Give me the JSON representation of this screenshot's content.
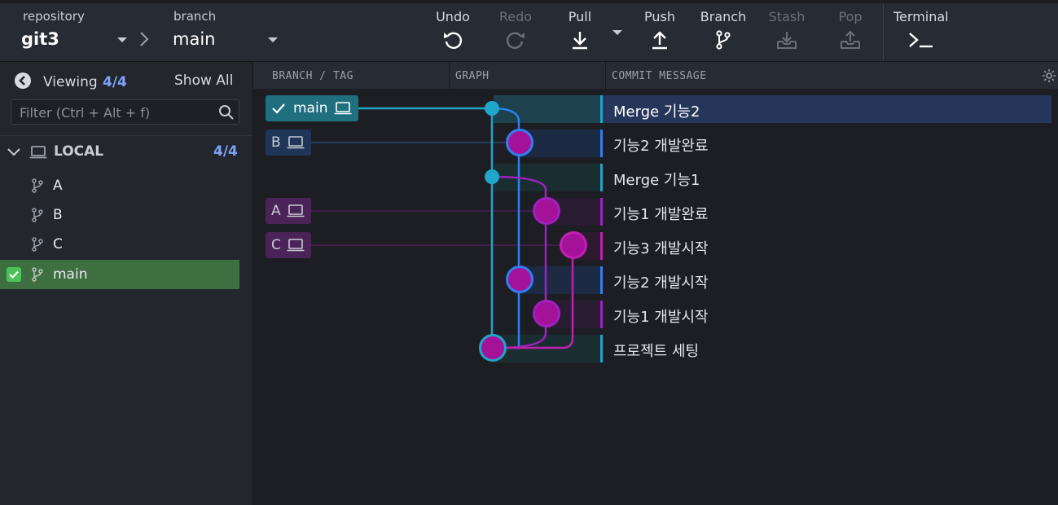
{
  "toolbar": {
    "repo_label": "repository",
    "repo_value": "git3",
    "branch_label": "branch",
    "branch_value": "main",
    "undo": "Undo",
    "redo": "Redo",
    "pull": "Pull",
    "push": "Push",
    "branch": "Branch",
    "stash": "Stash",
    "pop": "Pop",
    "terminal": "Terminal"
  },
  "left_panel": {
    "viewing_label": "Viewing",
    "viewing_count": "4/4",
    "show_all": "Show All",
    "filter_placeholder": "Filter (Ctrl + Alt + f)",
    "local_label": "LOCAL",
    "local_count": "4/4",
    "branches": [
      "A",
      "B",
      "C",
      "main"
    ],
    "active_branch": "main"
  },
  "columns": {
    "branch_tag": "BRANCH / TAG",
    "graph": "GRAPH",
    "commit_message": "COMMIT MESSAGE"
  },
  "refs": [
    {
      "name": "main",
      "checked": true,
      "color": "#1f6f7f"
    },
    {
      "name": "B",
      "checked": false,
      "color": "#203659"
    },
    {
      "name": "A",
      "checked": false,
      "color": "#4a2358"
    },
    {
      "name": "C",
      "checked": false,
      "color": "#4a2358"
    }
  ],
  "commits": [
    {
      "message": "Merge 기능2",
      "color": "#1fa6c8",
      "selected": true
    },
    {
      "message": "기능2 개발완료",
      "color": "#2f7ff0"
    },
    {
      "message": "Merge 기능1",
      "color": "#1fa6c8"
    },
    {
      "message": "기능1 개발완료",
      "color": "#a020c0"
    },
    {
      "message": "기능3 개발시작",
      "color": "#c020b0"
    },
    {
      "message": "기능2 개발시작",
      "color": "#2f7ff0"
    },
    {
      "message": "기능1 개발시작",
      "color": "#a020c0"
    },
    {
      "message": "프로젝트 세팅",
      "color": "#1fa6c8"
    }
  ],
  "colors": {
    "lane_main": "#1fa6c8",
    "lane_b": "#2f7ff0",
    "lane_a": "#a020c0",
    "lane_c": "#c020b0",
    "active_branch_bg": "#3d6f40",
    "accent_count": "#7aa2f7"
  }
}
